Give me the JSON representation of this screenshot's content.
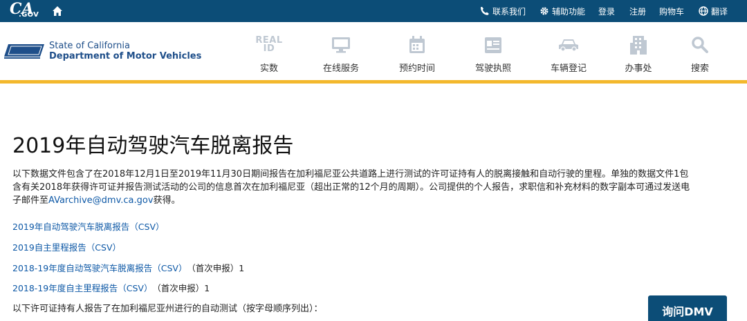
{
  "topbar": {
    "logo_text": "CA",
    "logo_sub": ".GOV",
    "utilities": [
      {
        "label": "联系我们",
        "icon": "phone-icon"
      },
      {
        "label": "辅助功能",
        "icon": "gear-icon"
      },
      {
        "label": "登录"
      },
      {
        "label": "注册"
      },
      {
        "label": "购物车"
      },
      {
        "label": "翻译",
        "icon": "globe-icon"
      }
    ]
  },
  "header": {
    "agency_line1": "State of California",
    "agency_line2": "Department of Motor Vehicles",
    "real_id_text": [
      "REAL",
      "ID"
    ],
    "nav": [
      {
        "label": "实数",
        "icon": "real-id-icon"
      },
      {
        "label": "在线服务",
        "icon": "monitor-icon"
      },
      {
        "label": "预约时间",
        "icon": "calendar-icon"
      },
      {
        "label": "驾驶执照",
        "icon": "license-card-icon"
      },
      {
        "label": "车辆登记",
        "icon": "car-icon"
      },
      {
        "label": "办事处",
        "icon": "building-icon"
      },
      {
        "label": "搜索",
        "icon": "search-icon"
      }
    ],
    "accent_color": "#f3b82d",
    "brand_color": "#0c4d77"
  },
  "main": {
    "title": "2019年自动驾驶汽车脱离报告",
    "intro_text": "以下数据文件包含了在2018年12月1日至2019年11月30日期间报告在加利福尼亚公共道路上进行测试的许可证持有人的脱离接触和自动行驶的里程。单独的数据文件1包含有关2018年获得许可证并报告测试活动的公司的信息首次在加利福尼亚（超出正常的12个月的周期）。公司提供的个人报告，求职信和补充材料的数字副本可通过发送电子邮件至",
    "intro_email": "AVarchive@dmv.ca.gov",
    "intro_end": "获得。",
    "links": [
      {
        "label": "2019年自动驾驶汽车脱离报告（CSV）",
        "note": ""
      },
      {
        "label": "2019自主里程报告（CSV）",
        "note": ""
      },
      {
        "label": "2018-19年度自动驾驶汽车脱离报告（CSV）",
        "note": "（首次申报）1"
      },
      {
        "label": "2018-19年度自主里程报告（CSV）",
        "note": "（首次申报）1"
      }
    ],
    "list_intro": "以下许可证持有人报告了在加利福尼亚州进行的自动测试（按字母顺序列出）：",
    "ask_button": "询问DMV"
  }
}
